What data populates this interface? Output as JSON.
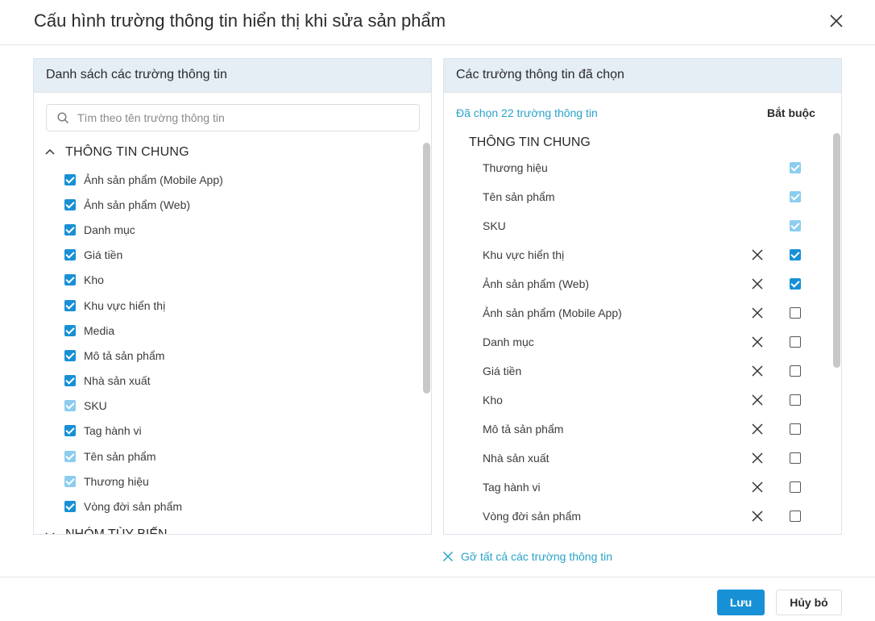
{
  "dialog": {
    "title": "Cấu hình trường thông tin hiển thị khi sửa sản phẩm"
  },
  "left_panel": {
    "header": "Danh sách các trường thông tin",
    "search_placeholder": "Tìm theo tên trường thông tin",
    "group_general": "THÔNG TIN CHUNG",
    "group_custom": "NHÓM TÙY BIẾN",
    "fields": [
      {
        "label": "Ảnh sản phẩm (Mobile App)",
        "state": "checked"
      },
      {
        "label": "Ảnh sản phẩm (Web)",
        "state": "checked"
      },
      {
        "label": "Danh mục",
        "state": "checked"
      },
      {
        "label": "Giá tiền",
        "state": "checked"
      },
      {
        "label": "Kho",
        "state": "checked"
      },
      {
        "label": "Khu vực hiển thị",
        "state": "checked"
      },
      {
        "label": "Media",
        "state": "checked"
      },
      {
        "label": "Mô tả sản phẩm",
        "state": "checked"
      },
      {
        "label": "Nhà sản xuất",
        "state": "checked"
      },
      {
        "label": "SKU",
        "state": "checked-disabled"
      },
      {
        "label": "Tag hành vi",
        "state": "checked"
      },
      {
        "label": "Tên sản phẩm",
        "state": "checked-disabled"
      },
      {
        "label": "Thương hiệu",
        "state": "checked-disabled"
      },
      {
        "label": "Vòng đời sản phẩm",
        "state": "checked"
      }
    ]
  },
  "right_panel": {
    "header": "Các trường thông tin đã chọn",
    "selected_count": "Đã chọn 22 trường thông tin",
    "required_header": "Bắt buộc",
    "group_general": "THÔNG TIN CHUNG",
    "fields": [
      {
        "label": "Thương hiệu",
        "removable": false,
        "required": "checked-disabled"
      },
      {
        "label": "Tên sản phẩm",
        "removable": false,
        "required": "checked-disabled"
      },
      {
        "label": "SKU",
        "removable": false,
        "required": "checked-disabled"
      },
      {
        "label": "Khu vực hiển thị",
        "removable": true,
        "required": "checked"
      },
      {
        "label": "Ảnh sản phẩm (Web)",
        "removable": true,
        "required": "checked"
      },
      {
        "label": "Ảnh sản phẩm (Mobile App)",
        "removable": true,
        "required": "unchecked"
      },
      {
        "label": "Danh mục",
        "removable": true,
        "required": "unchecked"
      },
      {
        "label": "Giá tiền",
        "removable": true,
        "required": "unchecked"
      },
      {
        "label": "Kho",
        "removable": true,
        "required": "unchecked"
      },
      {
        "label": "Mô tả sản phẩm",
        "removable": true,
        "required": "unchecked"
      },
      {
        "label": "Nhà sản xuất",
        "removable": true,
        "required": "unchecked"
      },
      {
        "label": "Tag hành vi",
        "removable": true,
        "required": "unchecked"
      },
      {
        "label": "Vòng đời sản phẩm",
        "removable": true,
        "required": "unchecked"
      }
    ]
  },
  "clear_all_label": "Gỡ tất cả các trường thông tin",
  "footer": {
    "save_label": "Lưu",
    "cancel_label": "Hủy bỏ"
  },
  "colors": {
    "accent": "#1890d6",
    "accent_disabled": "#8ccdee",
    "link": "#2aa3c9",
    "panel_header_bg": "#e5edf5"
  }
}
